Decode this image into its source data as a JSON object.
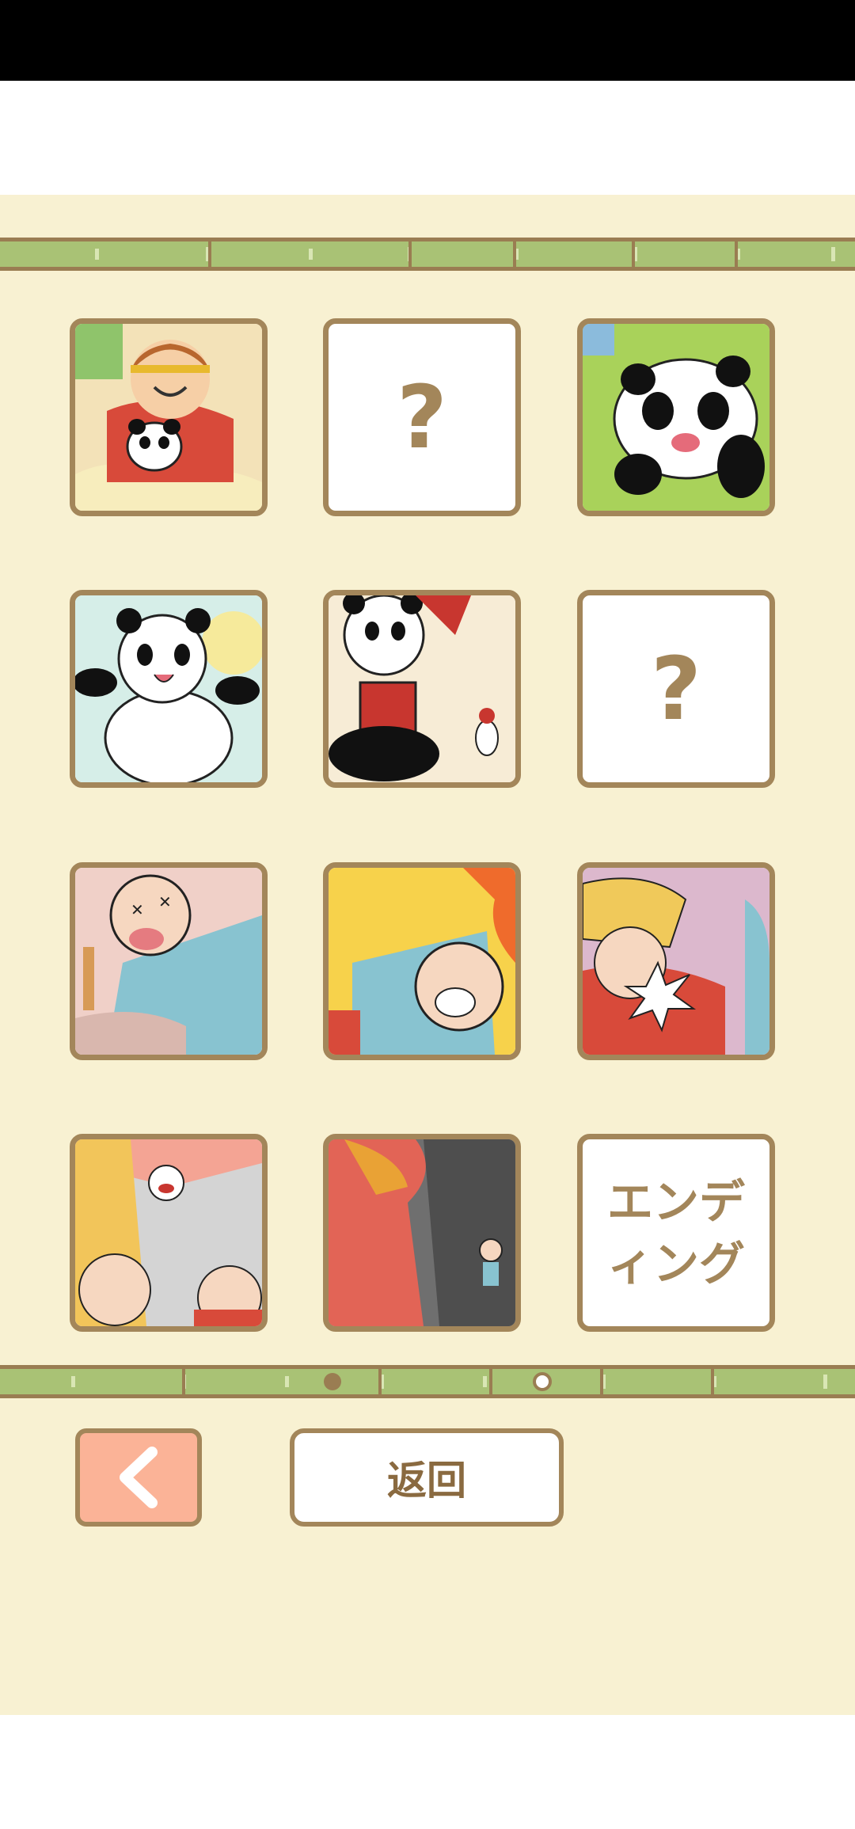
{
  "tiles": [
    {
      "state": "unlocked",
      "scene": "monkey-king-holding-panda"
    },
    {
      "state": "locked",
      "label": "?"
    },
    {
      "state": "unlocked",
      "scene": "crying-panda"
    },
    {
      "state": "unlocked",
      "scene": "happy-panda-jumping"
    },
    {
      "state": "unlocked",
      "scene": "panda-with-extinguisher"
    },
    {
      "state": "locked",
      "label": "?"
    },
    {
      "state": "unlocked",
      "scene": "old-man-fainted"
    },
    {
      "state": "unlocked",
      "scene": "old-man-by-fire"
    },
    {
      "state": "unlocked",
      "scene": "blond-man-shouting"
    },
    {
      "state": "unlocked",
      "scene": "surprised-cat-scene"
    },
    {
      "state": "unlocked",
      "scene": "man-looking-down-hole"
    },
    {
      "state": "ending",
      "label_line1": "エンデ",
      "label_line2": "ィング"
    }
  ],
  "pagination": {
    "current_page": 1,
    "total_pages": 2
  },
  "buttons": {
    "back_icon": "chevron-left-icon",
    "return_label": "返回"
  },
  "colors": {
    "frame": "#a3865a",
    "background": "#f8f1d2",
    "bamboo": "#a9c275",
    "back_button": "#fbb397"
  }
}
